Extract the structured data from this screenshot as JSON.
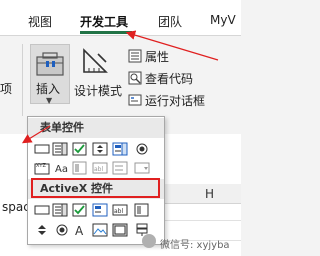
{
  "tabs": [
    {
      "label": "视图",
      "active": false
    },
    {
      "label": "开发工具",
      "active": true
    },
    {
      "label": "团队",
      "active": false
    },
    {
      "label": "MyV",
      "active": false
    }
  ],
  "ribbon": {
    "left_partial": "项",
    "insert_label": "插入",
    "design_mode_label": "设计模式",
    "properties_label": "属性",
    "view_code_label": "查看代码",
    "run_dialog_label": "运行对话框"
  },
  "dropdown": {
    "form_controls_header": "表单控件",
    "activex_header": "ActiveX 控件"
  },
  "sheet": {
    "column_header": "H",
    "cell_partial": "spac"
  },
  "watermark": {
    "text": "微信号: xyjyba"
  },
  "colors": {
    "accent": "#217346",
    "highlight": "#e02020",
    "arrow": "#e02020"
  }
}
